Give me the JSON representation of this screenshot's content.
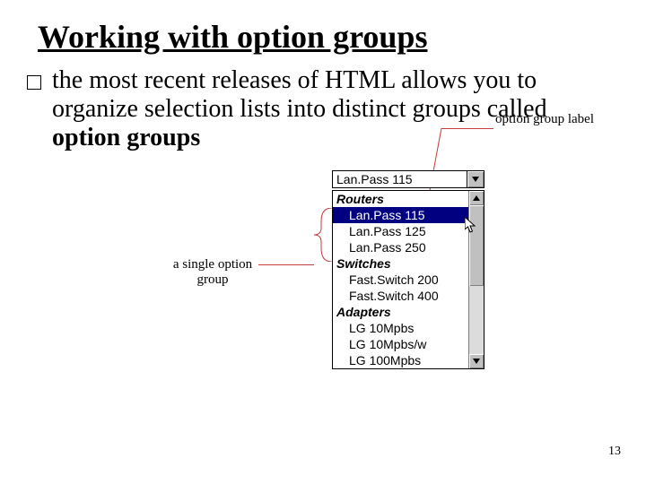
{
  "title": "Working with option groups",
  "body": {
    "t1": "the most recent releases of HTML allows you to organize selection lists into distinct groups called ",
    "t2": "option groups"
  },
  "annot": {
    "label": "option group label",
    "group": "a single option group"
  },
  "combo": {
    "selected": "Lan.Pass 115"
  },
  "groups": [
    {
      "label": "Routers",
      "options": [
        "Lan.Pass 115",
        "Lan.Pass 125",
        "Lan.Pass 250"
      ]
    },
    {
      "label": "Switches",
      "options": [
        "Fast.Switch 200",
        "Fast.Switch 400"
      ]
    },
    {
      "label": "Adapters",
      "options": [
        "LG 10Mpbs",
        "LG 10Mpbs/w",
        "LG 100Mpbs"
      ]
    }
  ],
  "page": "13"
}
